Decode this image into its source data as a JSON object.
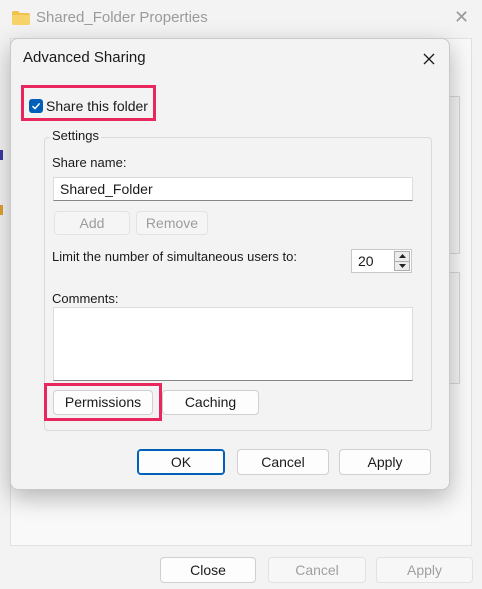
{
  "background_window": {
    "title": "Shared_Folder Properties",
    "footer_buttons": {
      "close": "Close",
      "cancel": "Cancel",
      "apply": "Apply"
    }
  },
  "dialog": {
    "title": "Advanced Sharing",
    "share_checkbox": {
      "label": "Share this folder",
      "checked": true
    },
    "settings": {
      "legend": "Settings",
      "share_name_label": "Share name:",
      "share_name_value": "Shared_Folder",
      "add_label": "Add",
      "remove_label": "Remove",
      "limit_label": "Limit the number of simultaneous users to:",
      "limit_value": "20",
      "comments_label": "Comments:",
      "comments_value": "",
      "permissions_label": "Permissions",
      "caching_label": "Caching"
    },
    "buttons": {
      "ok": "OK",
      "cancel": "Cancel",
      "apply": "Apply"
    }
  },
  "colors": {
    "accent": "#005fb8",
    "highlight": "#e8275f"
  }
}
